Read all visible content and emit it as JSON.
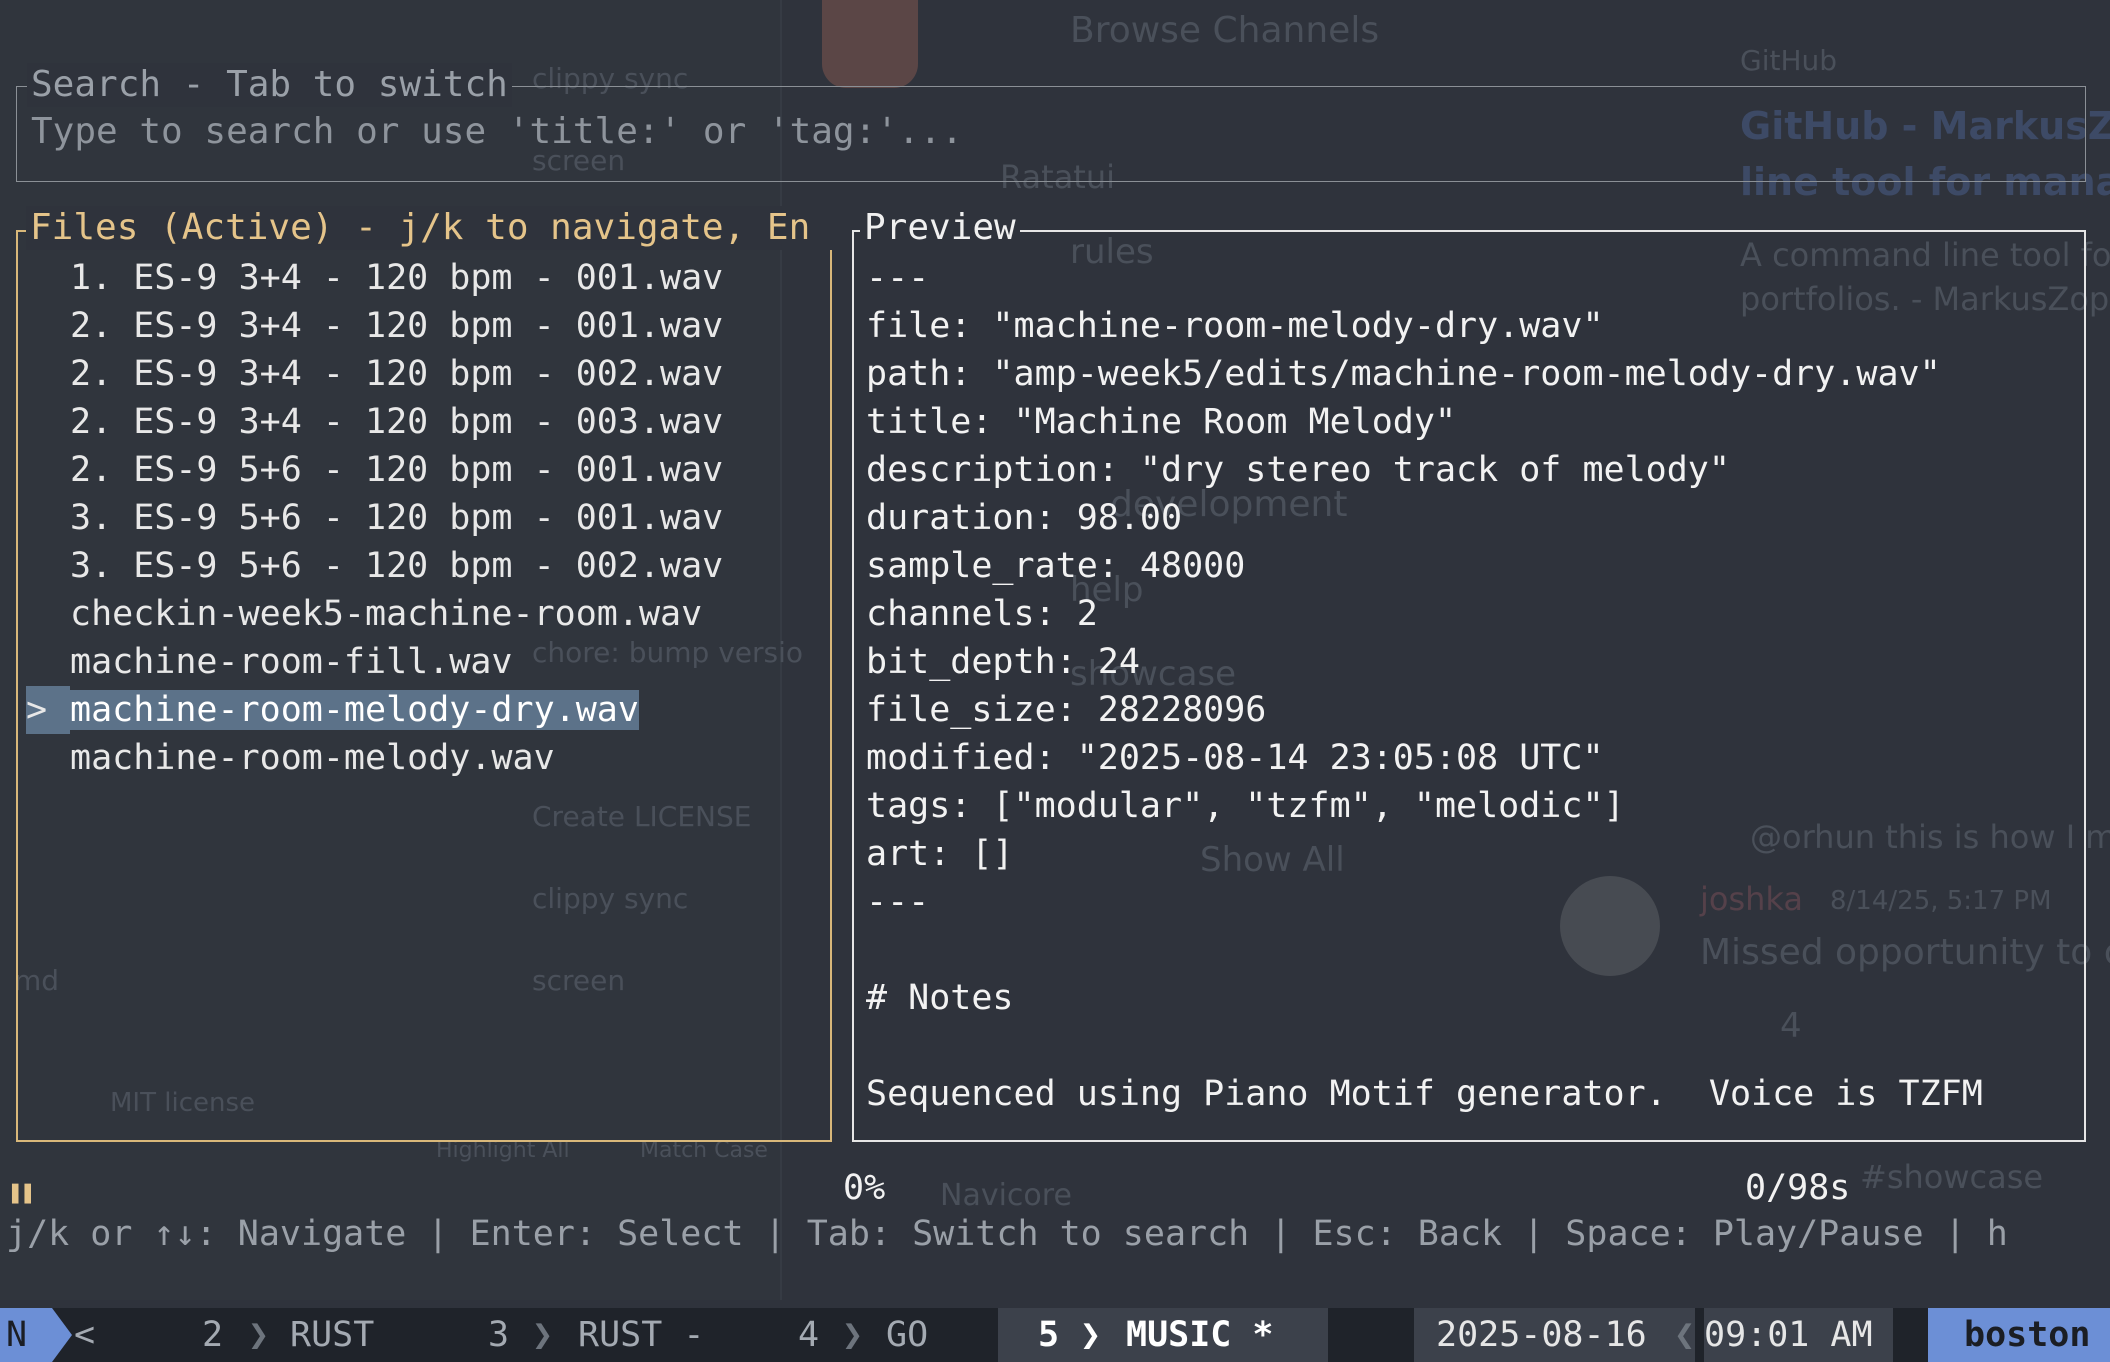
{
  "background_ghost": {
    "browse_channels": "Browse Channels",
    "github_header": "GitHub",
    "github_title_1": "GitHub - MarkusZopp",
    "github_title_2": "line tool for managi...",
    "github_desc_1": "A command line tool for",
    "github_desc_2": "portfolios. - MarkusZopp",
    "ratatui": "Ratatui",
    "rules": "rules",
    "development": "development",
    "help_ch": "help",
    "showcase": "showcase",
    "show_all": "Show All",
    "commit_1": "clippy sync",
    "commit_2": "screen",
    "commit_3": "chore: bump versio",
    "commit_4": "Create LICENSE",
    "mit": "MIT license",
    "highlight_all": "Highlight All",
    "match_case": "Match Case",
    "mention": "@orhun this is how I ma",
    "user": "joshka",
    "msg_time": "8/14/25, 5:17 PM",
    "msg_text": "Missed opportunity to ca",
    "reaction_count": "4",
    "navicore": "Navicore",
    "md": "md",
    "showcase_tag": "#showcase"
  },
  "search": {
    "title": "Search - Tab to switch",
    "placeholder": "Type to search or use 'title:' or 'tag:'..."
  },
  "files": {
    "title": "Files (Active) - j/k to navigate, En",
    "cursor": ">",
    "items": [
      "1. ES-9 3+4 - 120 bpm - 001.wav",
      "2. ES-9 3+4 - 120 bpm - 001.wav",
      "2. ES-9 3+4 - 120 bpm - 002.wav",
      "2. ES-9 3+4 - 120 bpm - 003.wav",
      "2. ES-9 5+6 - 120 bpm - 001.wav",
      "3. ES-9 5+6 - 120 bpm - 001.wav",
      "3. ES-9 5+6 - 120 bpm - 002.wav",
      "checkin-week5-machine-room.wav",
      "machine-room-fill.wav",
      "machine-room-melody-dry.wav",
      "machine-room-melody.wav"
    ],
    "selected_index": 9
  },
  "preview": {
    "title": "Preview",
    "frontmatter": [
      "---",
      "file: \"machine-room-melody-dry.wav\"",
      "path: \"amp-week5/edits/machine-room-melody-dry.wav\"",
      "title: \"Machine Room Melody\"",
      "description: \"dry stereo track of melody\"",
      "duration: 98.00",
      "sample_rate: 48000",
      "channels: 2",
      "bit_depth: 24",
      "file_size: 28228096",
      "modified: \"2025-08-14 23:05:08 UTC\"",
      "tags: [\"modular\", \"tzfm\", \"melodic\"]",
      "art: []",
      "---"
    ],
    "notes_heading": "# Notes",
    "notes_body": "Sequenced using Piano Motif generator.  Voice is TZFM"
  },
  "playback": {
    "icon": "pause-icon",
    "progress": "0%",
    "timecode": "0/98s"
  },
  "help_line": "j/k or ↑↓: Navigate | Enter: Select | Tab: Switch to search | Esc: Back | Space: Play/Pause | h",
  "statusbar": {
    "mode": "N",
    "scroll_left": "<",
    "tabs": [
      {
        "num": "2",
        "name": "RUST"
      },
      {
        "num": "3",
        "name": "RUST -"
      },
      {
        "num": "4",
        "name": "GO"
      },
      {
        "num": "5",
        "name": "MUSIC *"
      }
    ],
    "date": "2025-08-16",
    "time": "09:01 AM",
    "location": "boston"
  },
  "colors": {
    "files_border": "#d9b87a",
    "selection": "#5c7289",
    "mode_accent": "#6c8fd6"
  }
}
